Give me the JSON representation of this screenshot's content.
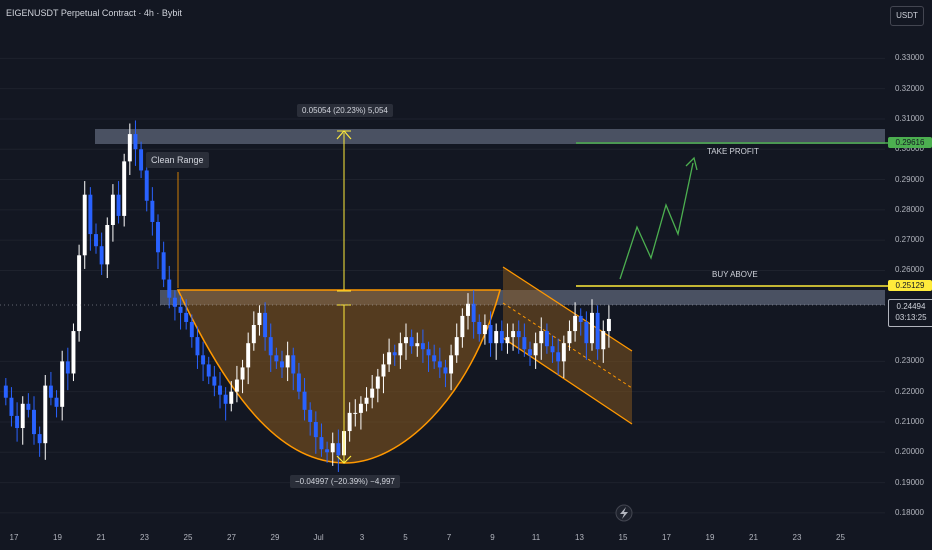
{
  "header": {
    "title": "EIGENUSDT Perpetual Contract · 4h · Bybit",
    "unit_button": "USDT"
  },
  "annotations": {
    "clean_range": "Clean Range",
    "measure_up": "0.05054 (20.23%) 5,054",
    "measure_down": "−0.04997 (−20.39%) −4,997",
    "take_profit": "TAKE PROFIT",
    "buy_above": "BUY ABOVE"
  },
  "price_tags": {
    "take_profit_price": "0.29616",
    "buy_price": "0.25129",
    "last_price": "0.24494",
    "countdown": "03:13:25"
  },
  "colors": {
    "background": "#131722",
    "up_candle": "#ffffff",
    "down_candle": "#2962ff",
    "cup_fill": "#8a5a1e",
    "cup_line": "#ff9800",
    "resistance_zone": "#5d6678",
    "take_profit_line": "#4caf50",
    "buy_line": "#ffeb3b",
    "measure_line": "#ffeb3b"
  },
  "icons": {
    "lightning": "lightning-icon"
  },
  "chart_data": {
    "type": "candlestick",
    "x_tick_labels": [
      "17",
      "19",
      "21",
      "23",
      "25",
      "27",
      "29",
      "Jul",
      "3",
      "5",
      "7",
      "9",
      "11",
      "13",
      "15",
      "17",
      "19",
      "21",
      "23",
      "25"
    ],
    "y_tick_labels": [
      "0.33000",
      "0.32000",
      "0.31000",
      "0.30000",
      "0.29000",
      "0.28000",
      "0.27000",
      "0.26000",
      "0.23000",
      "0.22000",
      "0.21000",
      "0.20000",
      "0.19000",
      "0.18000"
    ],
    "ylim": [
      0.176,
      0.341
    ],
    "levels": {
      "take_profit": 0.29616,
      "buy_above": 0.25129,
      "last": 0.24494,
      "resistance_zone": [
        0.2965,
        0.3005
      ],
      "range_zone": [
        0.2455,
        0.2505
      ]
    },
    "closes": [
      0.218,
      0.212,
      0.208,
      0.216,
      0.214,
      0.206,
      0.203,
      0.222,
      0.218,
      0.215,
      0.23,
      0.226,
      0.24,
      0.265,
      0.285,
      0.272,
      0.268,
      0.262,
      0.275,
      0.285,
      0.278,
      0.296,
      0.305,
      0.3,
      0.293,
      0.283,
      0.276,
      0.266,
      0.257,
      0.251,
      0.248,
      0.246,
      0.243,
      0.238,
      0.232,
      0.229,
      0.225,
      0.222,
      0.219,
      0.216,
      0.22,
      0.224,
      0.228,
      0.236,
      0.242,
      0.246,
      0.238,
      0.232,
      0.23,
      0.228,
      0.232,
      0.226,
      0.22,
      0.214,
      0.21,
      0.205,
      0.201,
      0.2,
      0.203,
      0.199,
      0.207,
      0.213,
      0.213,
      0.216,
      0.218,
      0.221,
      0.225,
      0.229,
      0.233,
      0.232,
      0.236,
      0.238,
      0.235,
      0.236,
      0.234,
      0.232,
      0.23,
      0.228,
      0.226,
      0.232,
      0.238,
      0.245,
      0.249,
      0.243,
      0.239,
      0.242,
      0.236,
      0.24,
      0.236,
      0.238,
      0.24,
      0.238,
      0.234,
      0.232,
      0.236,
      0.24,
      0.235,
      0.233,
      0.23,
      0.236,
      0.24,
      0.245,
      0.243,
      0.236,
      0.246,
      0.234,
      0.24,
      0.244
    ]
  }
}
